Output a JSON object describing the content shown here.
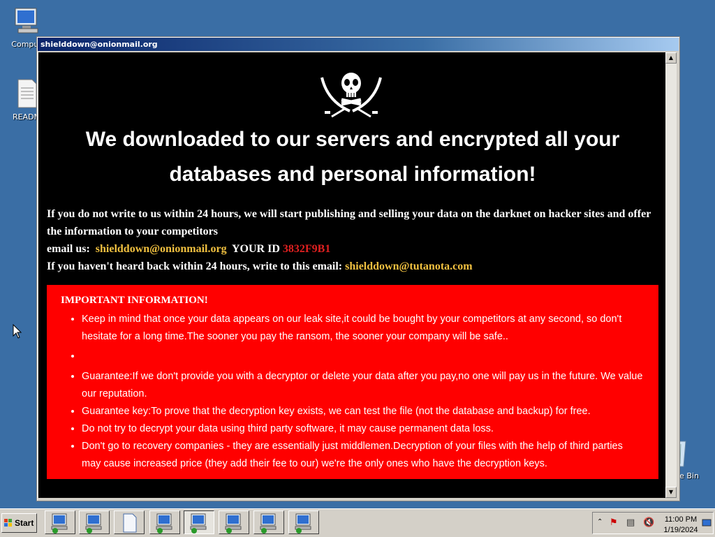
{
  "desktop": {
    "icons": [
      {
        "label": "Comput"
      },
      {
        "label": "READM"
      },
      {
        "label": "cle Bin"
      }
    ]
  },
  "window": {
    "title": "shielddown@onionmail.org"
  },
  "note": {
    "headline_line1": "We downloaded to our servers and encrypted all your",
    "headline_line2": "databases and personal information!",
    "intro_line1": "If you do not write to us within 24 hours, we will start publishing and selling your data on the darknet on hacker sites and offer the information to your competitors",
    "email_label": "email us:",
    "email_primary": "shielddown@onionmail.org",
    "id_label": "YOUR ID",
    "id_value": "3832F9B1",
    "fallback_text": "If you haven't heard back within 24 hours, write to this email:",
    "email_secondary": "shielddown@tutanota.com",
    "info_title": "IMPORTANT INFORMATION!",
    "info_items": [
      "Keep in mind that once your data appears on our leak site,it could be bought by your competitors at any second, so don't hesitate for a long time.The sooner you pay the ransom, the sooner your company will be safe..",
      "",
      "Guarantee:If we don't provide you with a decryptor or delete your data after you pay,no one will pay us in the future. We value our reputation.",
      "Guarantee key:To prove that the decryption key exists, we can test the file (not the database and backup) for free.",
      "Do not try to decrypt your data using third party software, it may cause permanent data loss.",
      "Don't go to recovery companies - they are essentially just middlemen.Decryption of your files with the help of third parties may cause increased price (they add their fee to our) we're the only ones who have the decryption keys."
    ],
    "colors": {
      "accent_yellow": "#f0c040",
      "id_red": "#e02020",
      "info_bg": "#ff0000"
    }
  },
  "taskbar": {
    "start_label": "Start",
    "buttons": [
      {
        "icon": "computer-network-icon"
      },
      {
        "icon": "computer-network-icon"
      },
      {
        "icon": "document-icon"
      },
      {
        "icon": "computer-network-icon"
      },
      {
        "icon": "computer-network-icon",
        "active": true
      },
      {
        "icon": "computer-network-icon"
      },
      {
        "icon": "computer-network-icon"
      },
      {
        "icon": "computer-network-icon"
      }
    ],
    "clock_time": "11:00 PM",
    "clock_date": "1/19/2024"
  }
}
